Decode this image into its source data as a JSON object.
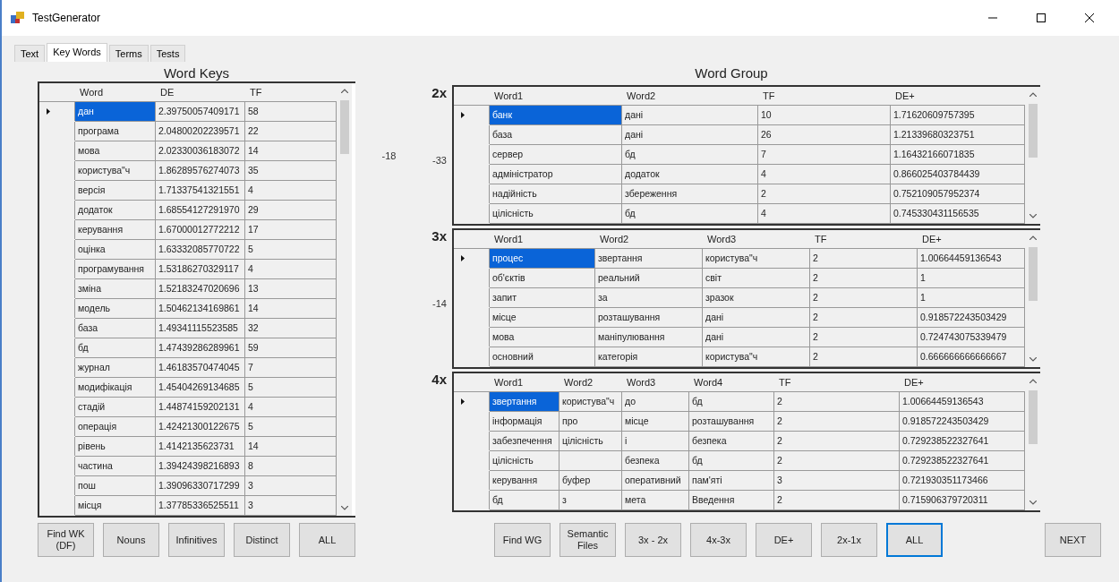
{
  "window": {
    "title": "TestGenerator"
  },
  "tabs": [
    {
      "label": "Text",
      "selected": false
    },
    {
      "label": "Key Words",
      "selected": true
    },
    {
      "label": "Terms",
      "selected": false
    },
    {
      "label": "Tests",
      "selected": false
    }
  ],
  "word_keys": {
    "title": "Word Keys",
    "delta": "-18",
    "columns": [
      "Word",
      "DE",
      "TF"
    ],
    "rows": [
      {
        "cells": [
          "дан",
          "2.39750057409171",
          "58"
        ],
        "selected": true
      },
      {
        "cells": [
          "програма",
          "2.04800202239571",
          "22"
        ],
        "selected": false
      },
      {
        "cells": [
          "мова",
          "2.02330036183072",
          "14"
        ],
        "selected": false
      },
      {
        "cells": [
          "користува\"ч",
          "1.86289576274073",
          "35"
        ],
        "selected": false
      },
      {
        "cells": [
          "версія",
          "1.71337541321551",
          "4"
        ],
        "selected": false
      },
      {
        "cells": [
          "додаток",
          "1.68554127291970",
          "29"
        ],
        "selected": false
      },
      {
        "cells": [
          "керування",
          "1.67000012772212",
          "17"
        ],
        "selected": false
      },
      {
        "cells": [
          "оцінка",
          "1.63332085770722",
          "5"
        ],
        "selected": false
      },
      {
        "cells": [
          "програмування",
          "1.53186270329117",
          "4"
        ],
        "selected": false
      },
      {
        "cells": [
          "зміна",
          "1.52183247020696",
          "13"
        ],
        "selected": false
      },
      {
        "cells": [
          "модель",
          "1.50462134169861",
          "14"
        ],
        "selected": false
      },
      {
        "cells": [
          "база",
          "1.49341115523585",
          "32"
        ],
        "selected": false
      },
      {
        "cells": [
          "бд",
          "1.47439286289961",
          "59"
        ],
        "selected": false
      },
      {
        "cells": [
          "журнал",
          "1.46183570474045",
          "7"
        ],
        "selected": false
      },
      {
        "cells": [
          "модифікація",
          "1.45404269134685",
          "5"
        ],
        "selected": false
      },
      {
        "cells": [
          "стадій",
          "1.44874159202131",
          "4"
        ],
        "selected": false
      },
      {
        "cells": [
          "операція",
          "1.42421300122675",
          "5"
        ],
        "selected": false
      },
      {
        "cells": [
          "рівень",
          "1.4142135623731",
          "14"
        ],
        "selected": false
      },
      {
        "cells": [
          "частина",
          "1.39424398216893",
          "8"
        ],
        "selected": false
      },
      {
        "cells": [
          "пош",
          "1.39096330717299",
          "3"
        ],
        "selected": false
      },
      {
        "cells": [
          "місця",
          "1.37785336525511",
          "3"
        ],
        "selected": false
      }
    ]
  },
  "word_group": {
    "title": "Word Group",
    "tables": [
      {
        "label": "2x",
        "delta": "-33",
        "columns": [
          "Word1",
          "Word2",
          "TF",
          "DE+"
        ],
        "rows": [
          {
            "cells": [
              "банк",
              "дані",
              "10",
              "1.71620609757395"
            ],
            "selected": true
          },
          {
            "cells": [
              "база",
              "дані",
              "26",
              "1.21339680323751"
            ],
            "selected": false
          },
          {
            "cells": [
              "сервер",
              "бд",
              "7",
              "1.16432166071835"
            ],
            "selected": false
          },
          {
            "cells": [
              "адміністратор",
              "додаток",
              "4",
              "0.866025403784439"
            ],
            "selected": false
          },
          {
            "cells": [
              "надійність",
              "збереження",
              "2",
              "0.752109057952374"
            ],
            "selected": false
          },
          {
            "cells": [
              "цілісність",
              "бд",
              "4",
              "0.745330431156535"
            ],
            "selected": false
          }
        ]
      },
      {
        "label": "3x",
        "delta": "-14",
        "columns": [
          "Word1",
          "Word2",
          "Word3",
          "TF",
          "DE+"
        ],
        "rows": [
          {
            "cells": [
              "процес",
              "звертання",
              "користува\"ч",
              "2",
              "1.00664459136543"
            ],
            "selected": true
          },
          {
            "cells": [
              "об'єктів",
              "реальний",
              "світ",
              "2",
              "1"
            ],
            "selected": false
          },
          {
            "cells": [
              "запит",
              "за",
              "зразок",
              "2",
              "1"
            ],
            "selected": false
          },
          {
            "cells": [
              "місце",
              "розташування",
              "дані",
              "2",
              "0.918572243503429"
            ],
            "selected": false
          },
          {
            "cells": [
              "мова",
              "маніпулювання",
              "дані",
              "2",
              "0.724743075339479"
            ],
            "selected": false
          },
          {
            "cells": [
              "основний",
              "категорія",
              "користува\"ч",
              "2",
              "0.666666666666667"
            ],
            "selected": false
          }
        ]
      },
      {
        "label": "4x",
        "columns": [
          "Word1",
          "Word2",
          "Word3",
          "Word4",
          "TF",
          "DE+"
        ],
        "rows": [
          {
            "cells": [
              "звертання",
              "користува\"ч",
              "до",
              "бд",
              "2",
              "1.00664459136543"
            ],
            "selected": true
          },
          {
            "cells": [
              "інформація",
              "про",
              "місце",
              "розташування",
              "2",
              "0.918572243503429"
            ],
            "selected": false
          },
          {
            "cells": [
              "забезпечення",
              "цілісність",
              "і",
              "безпека",
              "2",
              "0.729238522327641"
            ],
            "selected": false
          },
          {
            "cells": [
              "цілісність",
              null,
              "безпека",
              "бд",
              "2",
              "0.729238522327641"
            ],
            "selected": false
          },
          {
            "cells": [
              "керування",
              "буфер",
              "оперативний",
              "пам'яті",
              "3",
              "0.721930351173466"
            ],
            "selected": false
          },
          {
            "cells": [
              "бд",
              "з",
              "мета",
              "Введення",
              "2",
              "0.715906379720311"
            ],
            "selected": false
          }
        ]
      }
    ]
  },
  "left_buttons": [
    {
      "label": "Find WK\n(DF)",
      "focused": false
    },
    {
      "label": "Nouns",
      "focused": false
    },
    {
      "label": "Infinitives",
      "focused": false
    },
    {
      "label": "Distinct",
      "focused": false
    },
    {
      "label": "ALL",
      "focused": false
    }
  ],
  "right_buttons": [
    {
      "label": "Find WG",
      "focused": false
    },
    {
      "label": "Semantic\nFiles",
      "focused": false
    },
    {
      "label": "3x - 2x",
      "focused": false
    },
    {
      "label": "4x-3x",
      "focused": false
    },
    {
      "label": "DE+",
      "focused": false
    },
    {
      "label": "2x-1x",
      "focused": false
    },
    {
      "label": "ALL",
      "focused": true
    }
  ],
  "next_button": {
    "label": "NEXT"
  }
}
